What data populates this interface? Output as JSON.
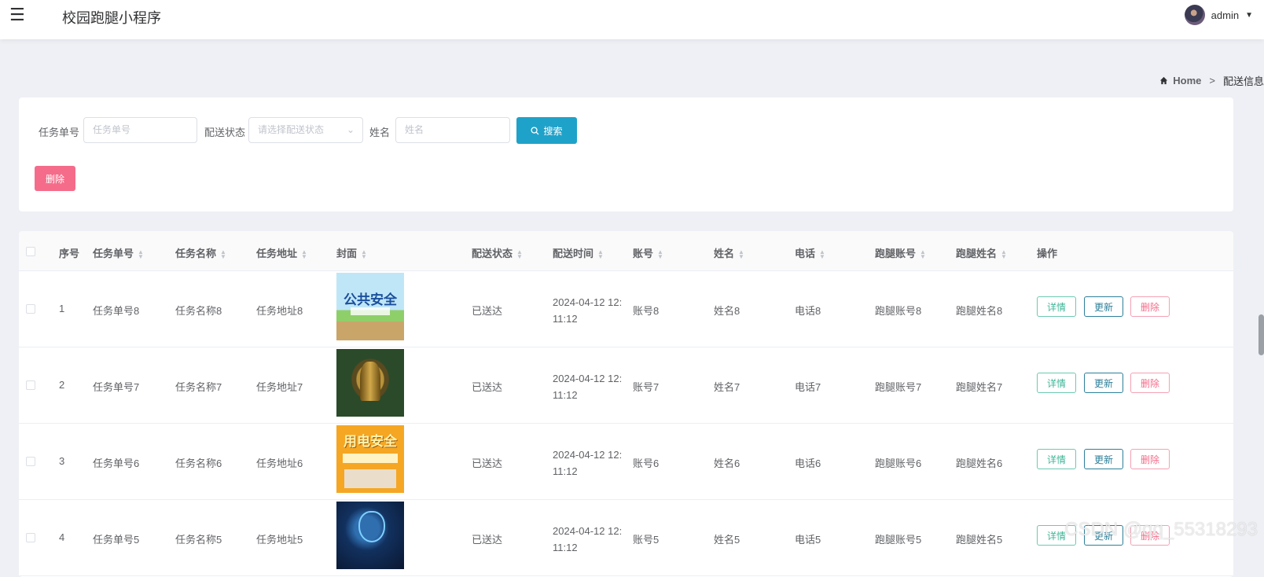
{
  "header": {
    "menu_icon": "☰",
    "app_title": "校园跑腿小程序",
    "username": "admin",
    "caret": "⌄"
  },
  "breadcrumb": {
    "home_icon": "home-icon",
    "home": "Home",
    "separator": ">",
    "current": "配送信息"
  },
  "search": {
    "task_no_label": "任务单号",
    "task_no_placeholder": "任务单号",
    "status_label": "配送状态",
    "status_placeholder": "请选择配送状态",
    "name_label": "姓名",
    "name_placeholder": "姓名",
    "search_button": "搜索",
    "delete_button": "删除"
  },
  "table": {
    "headers": {
      "index": "序号",
      "task_no": "任务单号",
      "task_name": "任务名称",
      "task_addr": "任务地址",
      "cover": "封面",
      "status": "配送状态",
      "time": "配送时间",
      "account": "账号",
      "name": "姓名",
      "phone": "电话",
      "runner_account": "跑腿账号",
      "runner_name": "跑腿姓名",
      "ops": "操作"
    },
    "ops": {
      "detail": "详情",
      "update": "更新",
      "delete": "删除"
    },
    "rows": [
      {
        "index": "1",
        "task_no": "任务单号8",
        "task_name": "任务名称8",
        "task_addr": "任务地址8",
        "cover_text": "公共安全",
        "status": "已送达",
        "time": "2024-04-12 12:11:12",
        "account": "账号8",
        "name": "姓名8",
        "phone": "电话8",
        "runner_account": "跑腿账号8",
        "runner_name": "跑腿姓名8"
      },
      {
        "index": "2",
        "task_no": "任务单号7",
        "task_name": "任务名称7",
        "task_addr": "任务地址7",
        "cover_text": "",
        "status": "已送达",
        "time": "2024-04-12 12:11:12",
        "account": "账号7",
        "name": "姓名7",
        "phone": "电话7",
        "runner_account": "跑腿账号7",
        "runner_name": "跑腿姓名7"
      },
      {
        "index": "3",
        "task_no": "任务单号6",
        "task_name": "任务名称6",
        "task_addr": "任务地址6",
        "cover_text": "用电安全",
        "status": "已送达",
        "time": "2024-04-12 12:11:12",
        "account": "账号6",
        "name": "姓名6",
        "phone": "电话6",
        "runner_account": "跑腿账号6",
        "runner_name": "跑腿姓名6"
      },
      {
        "index": "4",
        "task_no": "任务单号5",
        "task_name": "任务名称5",
        "task_addr": "任务地址5",
        "cover_text": "",
        "status": "已送达",
        "time": "2024-04-12 12:11:12",
        "account": "账号5",
        "name": "姓名5",
        "phone": "电话5",
        "runner_account": "跑腿账号5",
        "runner_name": "跑腿姓名5"
      }
    ]
  },
  "watermark": "CSDN @qq_55318293"
}
